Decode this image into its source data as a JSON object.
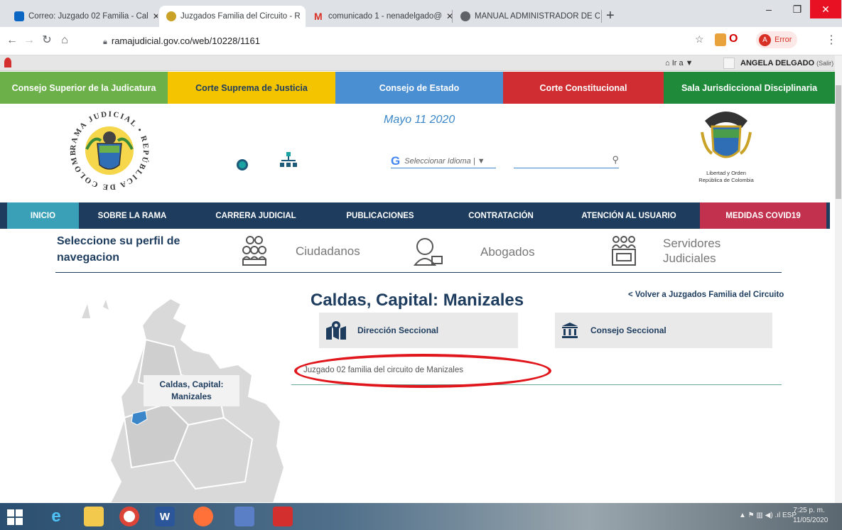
{
  "browser": {
    "tabs": [
      {
        "title": "Correo: Juzgado 02 Familia - Cal",
        "icon": "outlook-icon",
        "color": "#0a66c2"
      },
      {
        "title": "Juzgados Familia del Circuito - R",
        "icon": "rama-judicial-icon",
        "color": "#c9a227"
      },
      {
        "title": "comunicado 1 - nenadelgado@",
        "icon": "gmail-icon",
        "color": "#d93025"
      },
      {
        "title": "MANUAL ADMINISTRADOR DE C",
        "icon": "globe-icon",
        "color": "#5f6368"
      }
    ],
    "new_tab": "+",
    "url": "ramajudicial.gov.co/web/10228/1161",
    "profile_status": "Error",
    "profile_initial": "A"
  },
  "site": {
    "ira_label": "Ir a ▼",
    "user_name": "ANGELA DELGADO",
    "user_logout": "(Salir)",
    "courts": [
      {
        "label": "Consejo Superior de la Judicatura",
        "color": "#6cb04a"
      },
      {
        "label": "Corte Suprema de Justicia",
        "color": "#f5c400"
      },
      {
        "label": "Consejo de Estado",
        "color": "#4a8fd2"
      },
      {
        "label": "Corte Constitucional",
        "color": "#cf2d32"
      },
      {
        "label": "Sala Jurisdiccional Disciplinaria",
        "color": "#1f8a3a"
      }
    ],
    "date": "Mayo 11 2020",
    "language_placeholder": "Seleccionar Idioma",
    "seal_caption_line1": "Libertad y Orden",
    "seal_caption_line2": "República de Colombia",
    "logo_ring_text": "RAMA JUDICIAL • REPÚBLICA DE COLOMBIA",
    "nav": [
      {
        "label": "INICIO",
        "color": "#3aa0b8"
      },
      {
        "label": "SOBRE LA RAMA"
      },
      {
        "label": "CARRERA JUDICIAL"
      },
      {
        "label": "PUBLICACIONES"
      },
      {
        "label": "CONTRATACIÓN"
      },
      {
        "label": "ATENCIÓN AL USUARIO"
      },
      {
        "label": "MEDIDAS COVID19",
        "color": "#c2324e"
      }
    ],
    "profile_prompt_line1": "Seleccione su perfil de",
    "profile_prompt_line2": "navegacion",
    "profiles": [
      {
        "label": "Ciudadanos",
        "icon": "citizens-icon"
      },
      {
        "label": "Abogados",
        "icon": "lawyer-icon"
      },
      {
        "label_line1": "Servidores",
        "label_line2": "Judiciales",
        "icon": "servants-icon"
      }
    ],
    "heading": "Caldas, Capital: Manizales",
    "back_link": "< Volver a Juzgados Familia del Circuito",
    "cards": [
      {
        "label": "Dirección Seccional",
        "icon": "map-marker-icon"
      },
      {
        "label": "Consejo Seccional",
        "icon": "institution-icon"
      }
    ],
    "juzgado_link": "Juzgado 02 familia del circuito de Manizales",
    "map_tooltip_line1": "Caldas, Capital:",
    "map_tooltip_line2": "Manizales"
  },
  "taskbar": {
    "language": "ESP",
    "time": "7:25 p. m.",
    "date": "11/05/2020"
  }
}
